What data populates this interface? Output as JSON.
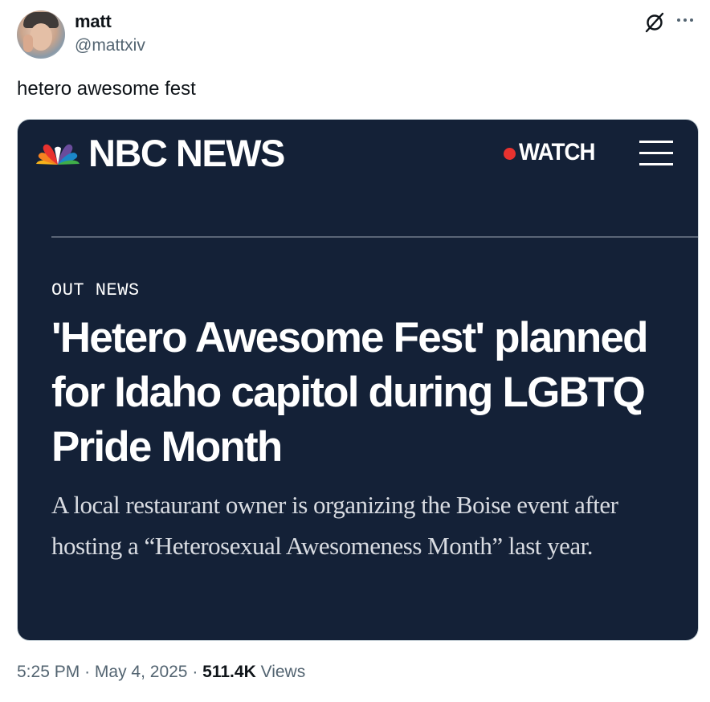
{
  "author": {
    "display_name": "matt",
    "handle": "@mattxiv"
  },
  "tweet": {
    "text": "hetero awesome fest",
    "time": "5:25 PM",
    "date": "May 4, 2025",
    "views_count": "511.4K",
    "views_label": "Views",
    "separator": "·"
  },
  "card": {
    "brand": "NBC NEWS",
    "watch_label": "WATCH",
    "section": "OUT NEWS",
    "headline": "'Hetero Awesome Fest' planned for Idaho capitol during LGBTQ Pride Month",
    "dek": "A local restaurant owner is organizing the Boise event after hosting a “Heterosexual Awesomeness Month” last year.",
    "background_color": "#142137",
    "live_dot_color": "#e8322f"
  },
  "icons": {
    "grok": "grok-icon",
    "more": "more-icon",
    "peacock": "nbc-peacock-icon",
    "menu": "hamburger-menu-icon"
  }
}
